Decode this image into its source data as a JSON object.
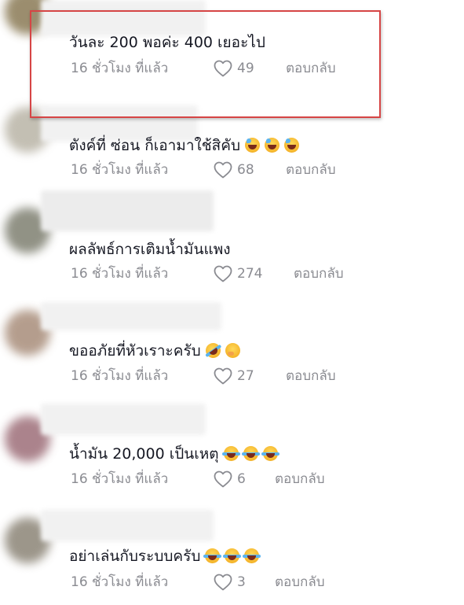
{
  "comments": [
    {
      "text": "วันละ 200 พอค่ะ 400 เยอะไป",
      "time": "16 ชั่วโมง ที่แล้ว",
      "likes": "49",
      "reply": "ตอบกลับ",
      "emojis": []
    },
    {
      "text": "ตังค์ที่ ซ่อน ก็เอามาใช้สิคับ",
      "time": "16 ชั่วโมง ที่แล้ว",
      "likes": "68",
      "reply": "ตอบกลับ",
      "emojis": [
        "grinning-sweat-emoji",
        "grinning-sweat-emoji",
        "grinning-sweat-emoji"
      ]
    },
    {
      "text": "ผลลัพธ์การเติมน้ำมันแพง",
      "time": "16 ชั่วโมง ที่แล้ว",
      "likes": "274",
      "reply": "ตอบกลับ",
      "emojis": []
    },
    {
      "text": "ขออภัยที่หัวเราะครับ",
      "time": "16 ชั่วโมง ที่แล้ว",
      "likes": "27",
      "reply": "ตอบกลับ",
      "emojis": [
        "rolling-laughing-emoji",
        "giggling-emoji"
      ]
    },
    {
      "text": "น้ำมัน 20,000 เป็นเหตุ",
      "time": "16 ชั่วโมง ที่แล้ว",
      "likes": "6",
      "reply": "ตอบกลับ",
      "emojis": [
        "tears-of-joy-emoji",
        "tears-of-joy-emoji",
        "tears-of-joy-emoji"
      ]
    },
    {
      "text": "อย่าเล่นกับระบบครับ",
      "time": "16 ชั่วโมง ที่แล้ว",
      "likes": "3",
      "reply": "ตอบกลับ",
      "emojis": [
        "tears-of-joy-emoji",
        "tears-of-joy-emoji",
        "tears-of-joy-emoji"
      ]
    }
  ],
  "colors": {
    "text": "#161823",
    "meta": "#8a8b91",
    "highlight_border": "#d64545"
  },
  "icons": {
    "like": "heart-outline-icon"
  }
}
